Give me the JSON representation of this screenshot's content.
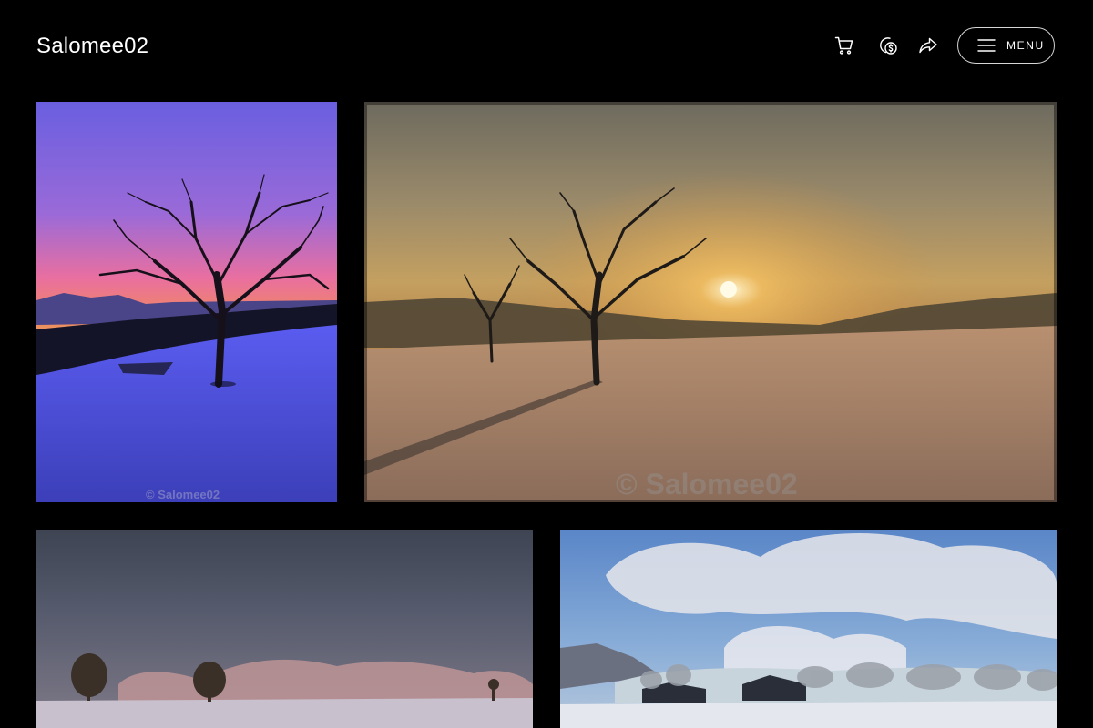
{
  "header": {
    "brand": "Salomee02",
    "icons": [
      "cart-icon",
      "price-tag-icon",
      "share-icon",
      "hamburger-icon"
    ],
    "menu_label": "MENU"
  },
  "gallery": {
    "photos": [
      {
        "watermark": "© Salomee02"
      },
      {
        "watermark": "© Salomee02"
      },
      {
        "watermark": ""
      },
      {
        "watermark": ""
      }
    ]
  },
  "colors": {
    "background": "#000000",
    "text": "#ffffff",
    "menu_border": "#d6d6d6"
  }
}
